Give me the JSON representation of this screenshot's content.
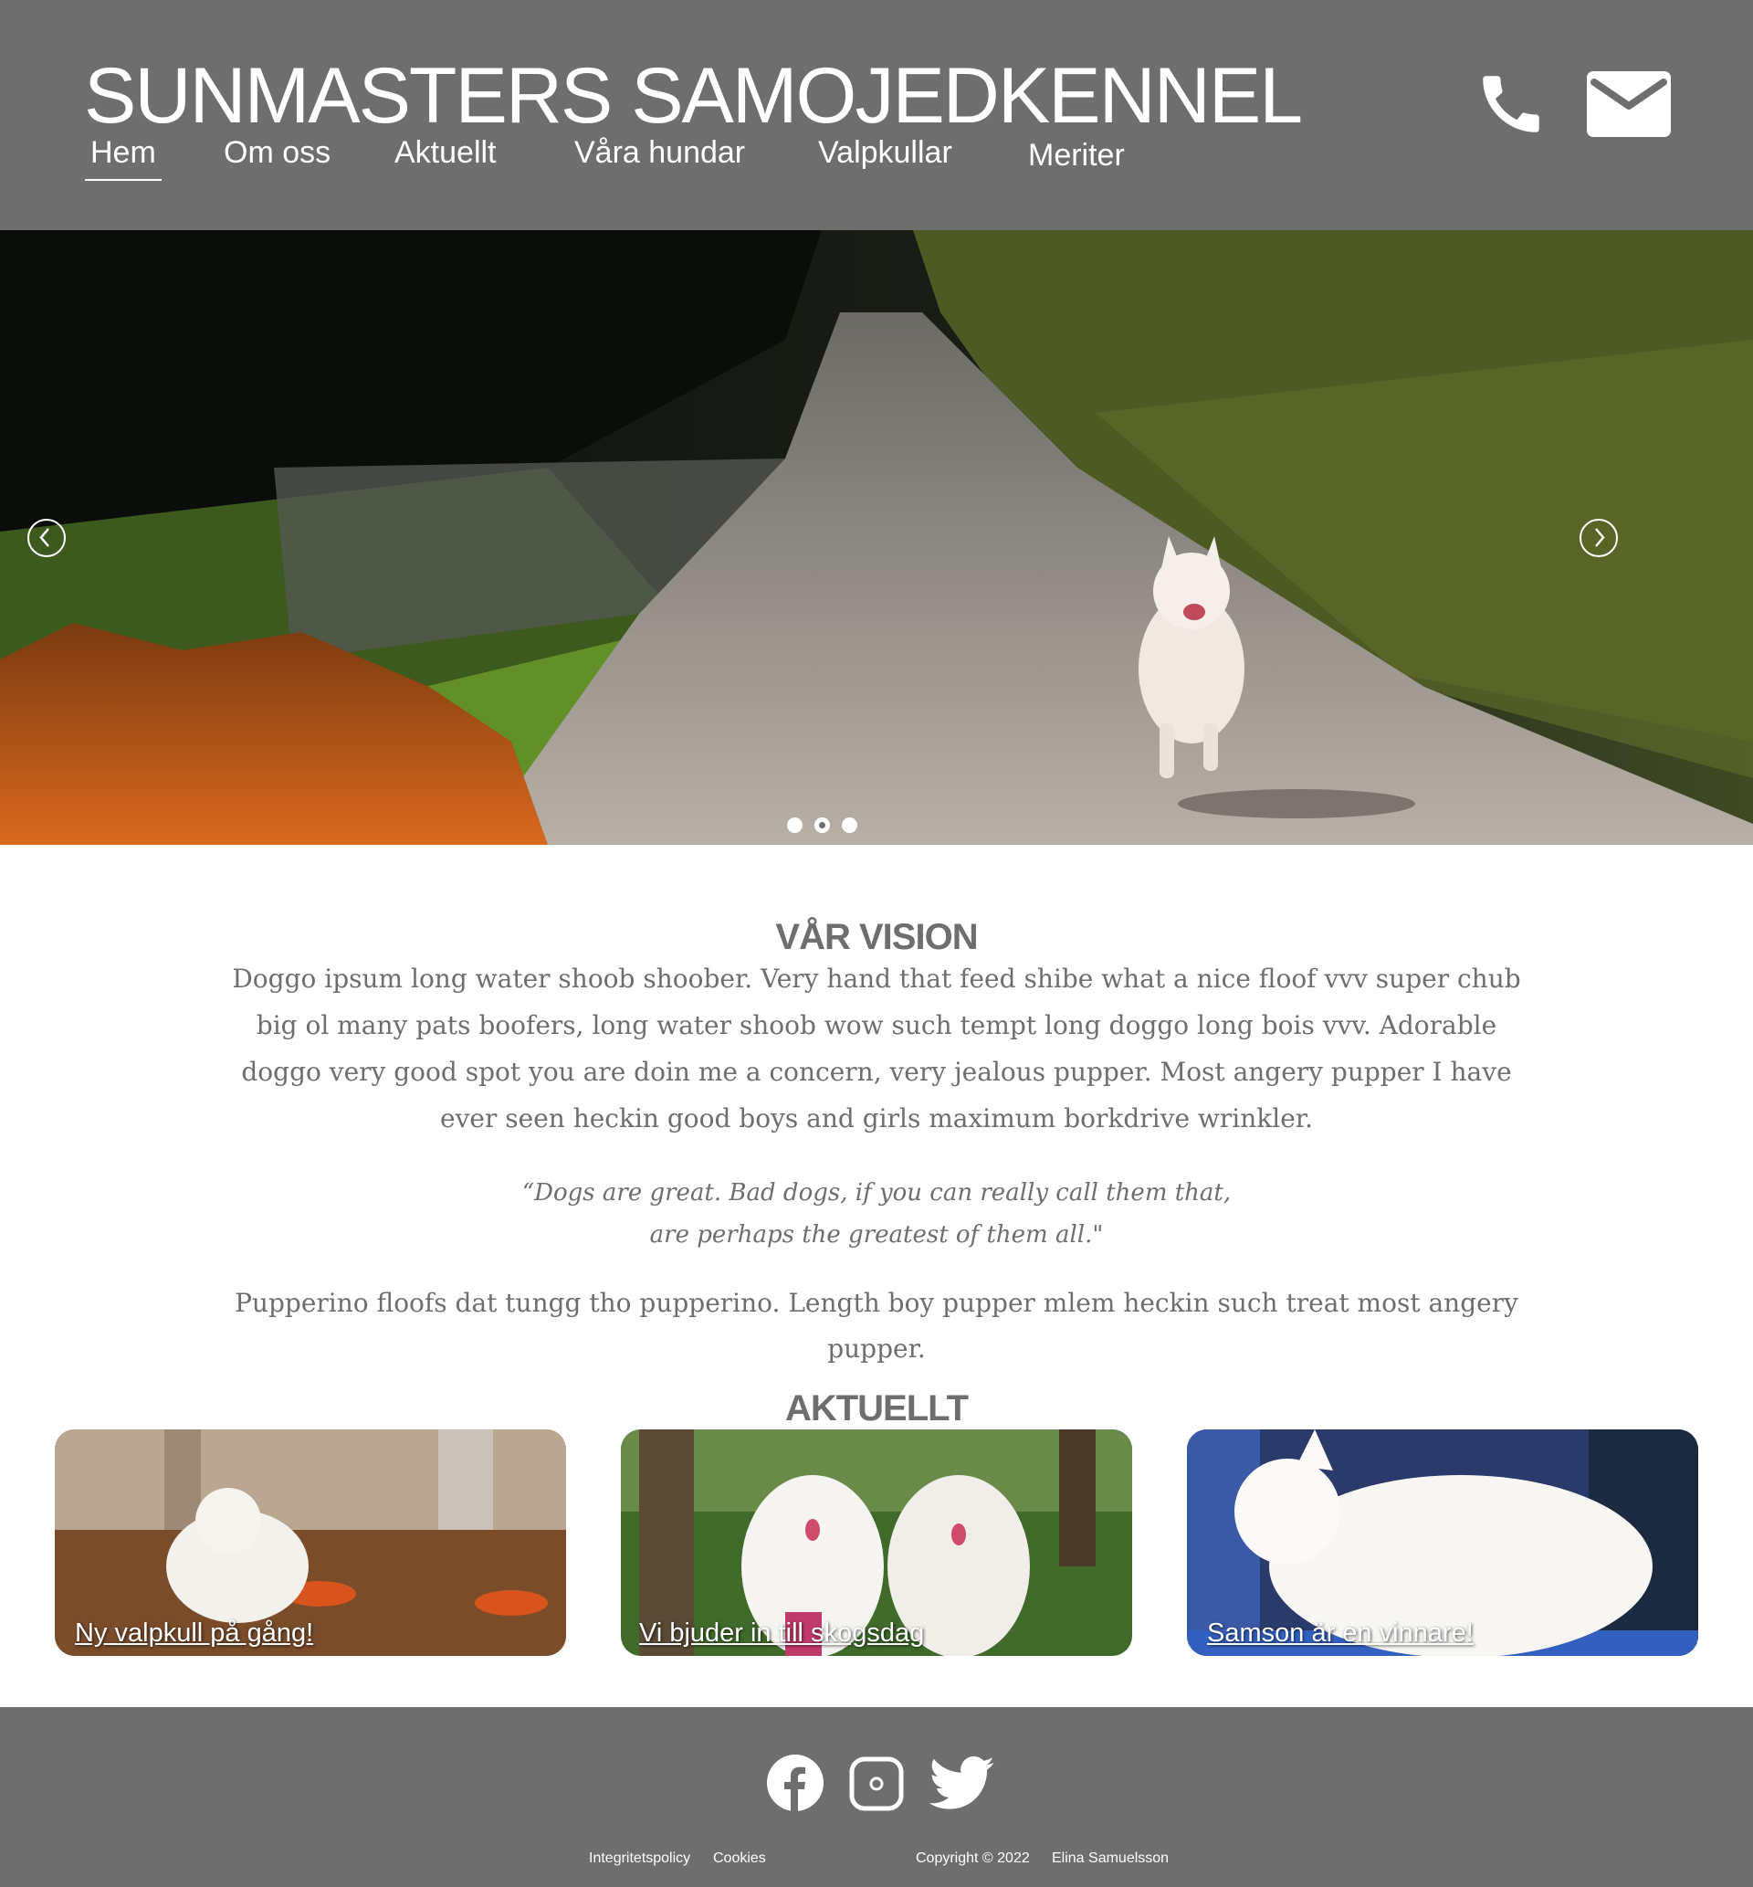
{
  "header": {
    "brand": "SUNMASTERS SAMOJEDKENNEL",
    "nav": [
      {
        "label": "Hem",
        "active": true
      },
      {
        "label": "Om oss",
        "active": false
      },
      {
        "label": "Aktuellt",
        "active": false
      },
      {
        "label": "Våra hundar",
        "active": false
      },
      {
        "label": "Valpkullar",
        "active": false
      },
      {
        "label": "Meriter",
        "active": false
      }
    ],
    "icons": [
      "phone-icon",
      "mail-icon"
    ]
  },
  "hero": {
    "slide_count": 3,
    "active_slide": 2,
    "controls": [
      "chevron-left-icon",
      "chevron-right-icon"
    ]
  },
  "vision": {
    "title": "VÅR VISION",
    "text": "Doggo ipsum long water shoob shoober. Very hand that feed shibe what a nice floof vvv super chub big ol many pats boofers, long water shoob wow such tempt long doggo long bois vvv. Adorable doggo very good spot you are doin me a concern, very jealous pupper. Most angery pupper I have ever seen heckin good boys and girls maximum borkdrive wrinkler.",
    "quote_line1": "“Dogs are great. Bad dogs, if you can really call them that,",
    "quote_line2": "are perhaps the greatest of them all.\"",
    "closing": "Pupperino floofs dat tungg tho pupperino. Length boy pupper mlem heckin such treat most angery pupper."
  },
  "news": {
    "title": "AKTUELLT",
    "cards": [
      {
        "label": "Ny valpkull på gång!"
      },
      {
        "label": "Vi bjuder in till skogsdag"
      },
      {
        "label": "Samson är en vinnare!"
      }
    ]
  },
  "footer": {
    "social": [
      "facebook-icon",
      "instagram-icon",
      "twitter-icon"
    ],
    "privacy": "Integritetspolicy",
    "cookies": "Cookies",
    "copyright": "Copyright © 2022",
    "author": "Elina Samuelsson"
  },
  "colors": {
    "header_bg": "#6e6e6e",
    "text": "#6e6e6e",
    "white": "#ffffff"
  }
}
